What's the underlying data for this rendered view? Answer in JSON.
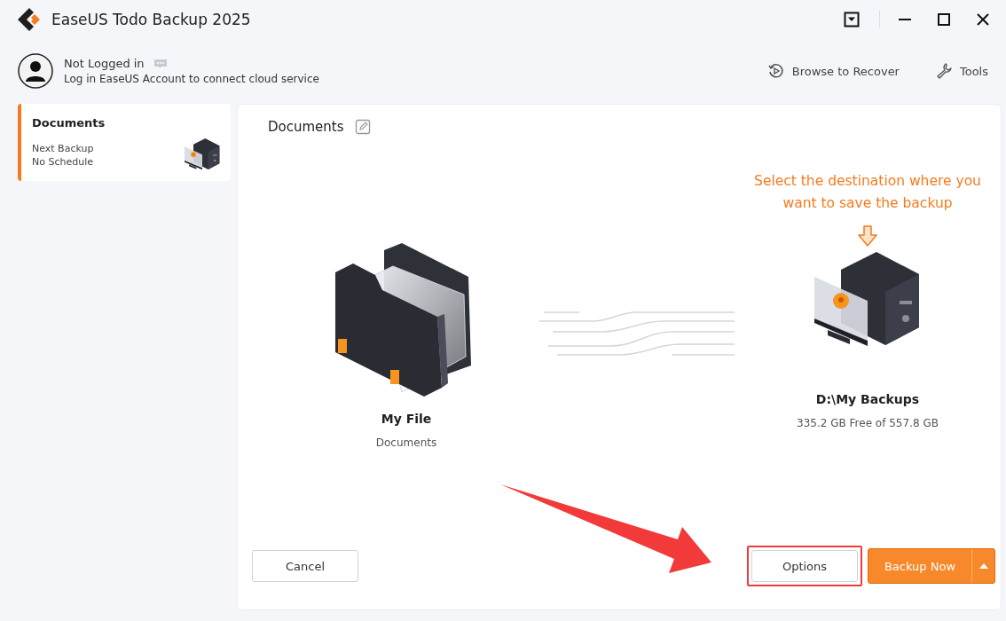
{
  "window": {
    "title": "EaseUS Todo Backup 2025"
  },
  "account": {
    "status": "Not Logged in",
    "hint": "Log in EaseUS Account to connect cloud service"
  },
  "toolbar": [
    {
      "kind": "recover",
      "label": "Browse to Recover"
    },
    {
      "kind": "tools",
      "label": "Tools"
    }
  ],
  "sidebar": {
    "items": [
      {
        "title": "Documents",
        "next_label": "Next Backup",
        "schedule": "No Schedule",
        "selected": true
      }
    ]
  },
  "task": {
    "title": "Documents",
    "source": {
      "name": "My File",
      "detail": "Documents"
    },
    "destination": {
      "hint": "Select the destination where you want to save the backup",
      "name": "D:\\My Backups",
      "detail": "335.2 GB Free of 557.8 GB"
    }
  },
  "buttons": {
    "cancel": "Cancel",
    "options": {
      "label": "Options",
      "highlighted": true
    },
    "primary": "Backup Now"
  }
}
